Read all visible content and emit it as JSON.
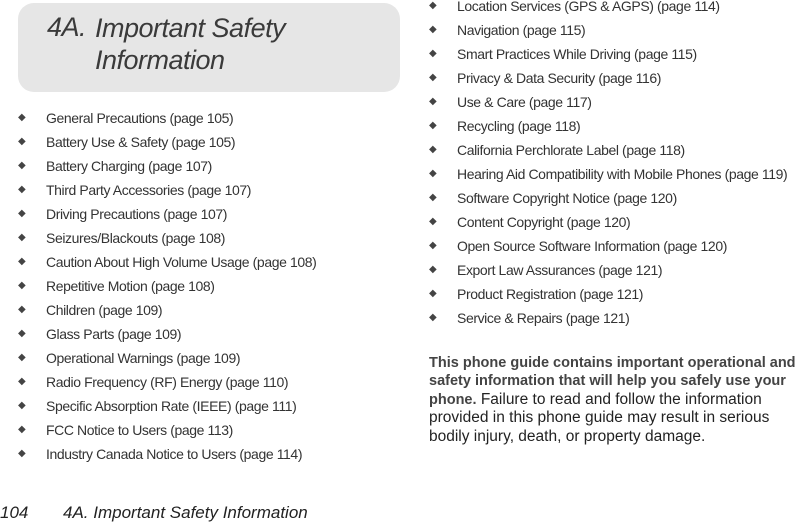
{
  "header": {
    "section_number": "4A.",
    "section_title": "Important Safety Information"
  },
  "bullet_icon": "diamond-bullet",
  "toc_left": [
    "General Precautions (page 105)",
    "Battery Use & Safety (page 105)",
    "Battery Charging (page 107)",
    "Third Party Accessories (page 107)",
    "Driving Precautions (page 107)",
    "Seizures/Blackouts (page 108)",
    "Caution About High Volume Usage (page 108)",
    "Repetitive Motion (page 108)",
    "Children (page 109)",
    "Glass Parts (page 109)",
    "Operational Warnings (page 109)",
    "Radio Frequency (RF) Energy (page 110)",
    "Specific Absorption Rate (IEEE) (page 111)",
    "FCC Notice to Users (page 113)",
    "Industry Canada Notice to Users (page 114)"
  ],
  "toc_right": [
    "Location Services (GPS & AGPS) (page 114)",
    "Navigation (page 115)",
    "Smart Practices While Driving (page 115)",
    "Privacy & Data Security (page 116)",
    "Use & Care (page 117)",
    "Recycling (page 118)",
    "California Perchlorate Label (page 118)",
    "Hearing Aid Compatibility with Mobile Phones (page 119)",
    "Software Copyright Notice (page 120)",
    "Content Copyright (page 120)",
    "Open Source Software Information (page 120)",
    "Export Law Assurances (page 121)",
    "Product Registration (page 121)",
    "Service & Repairs (page 121)"
  ],
  "intro": {
    "bold": "This phone guide contains important operational and safety information that will help you safely use your phone.",
    "regular": " Failure to read and follow the information provided in this phone guide may result in serious bodily injury, death, or property damage."
  },
  "footer": {
    "page_number": "104",
    "section": "4A. Important Safety Information"
  }
}
